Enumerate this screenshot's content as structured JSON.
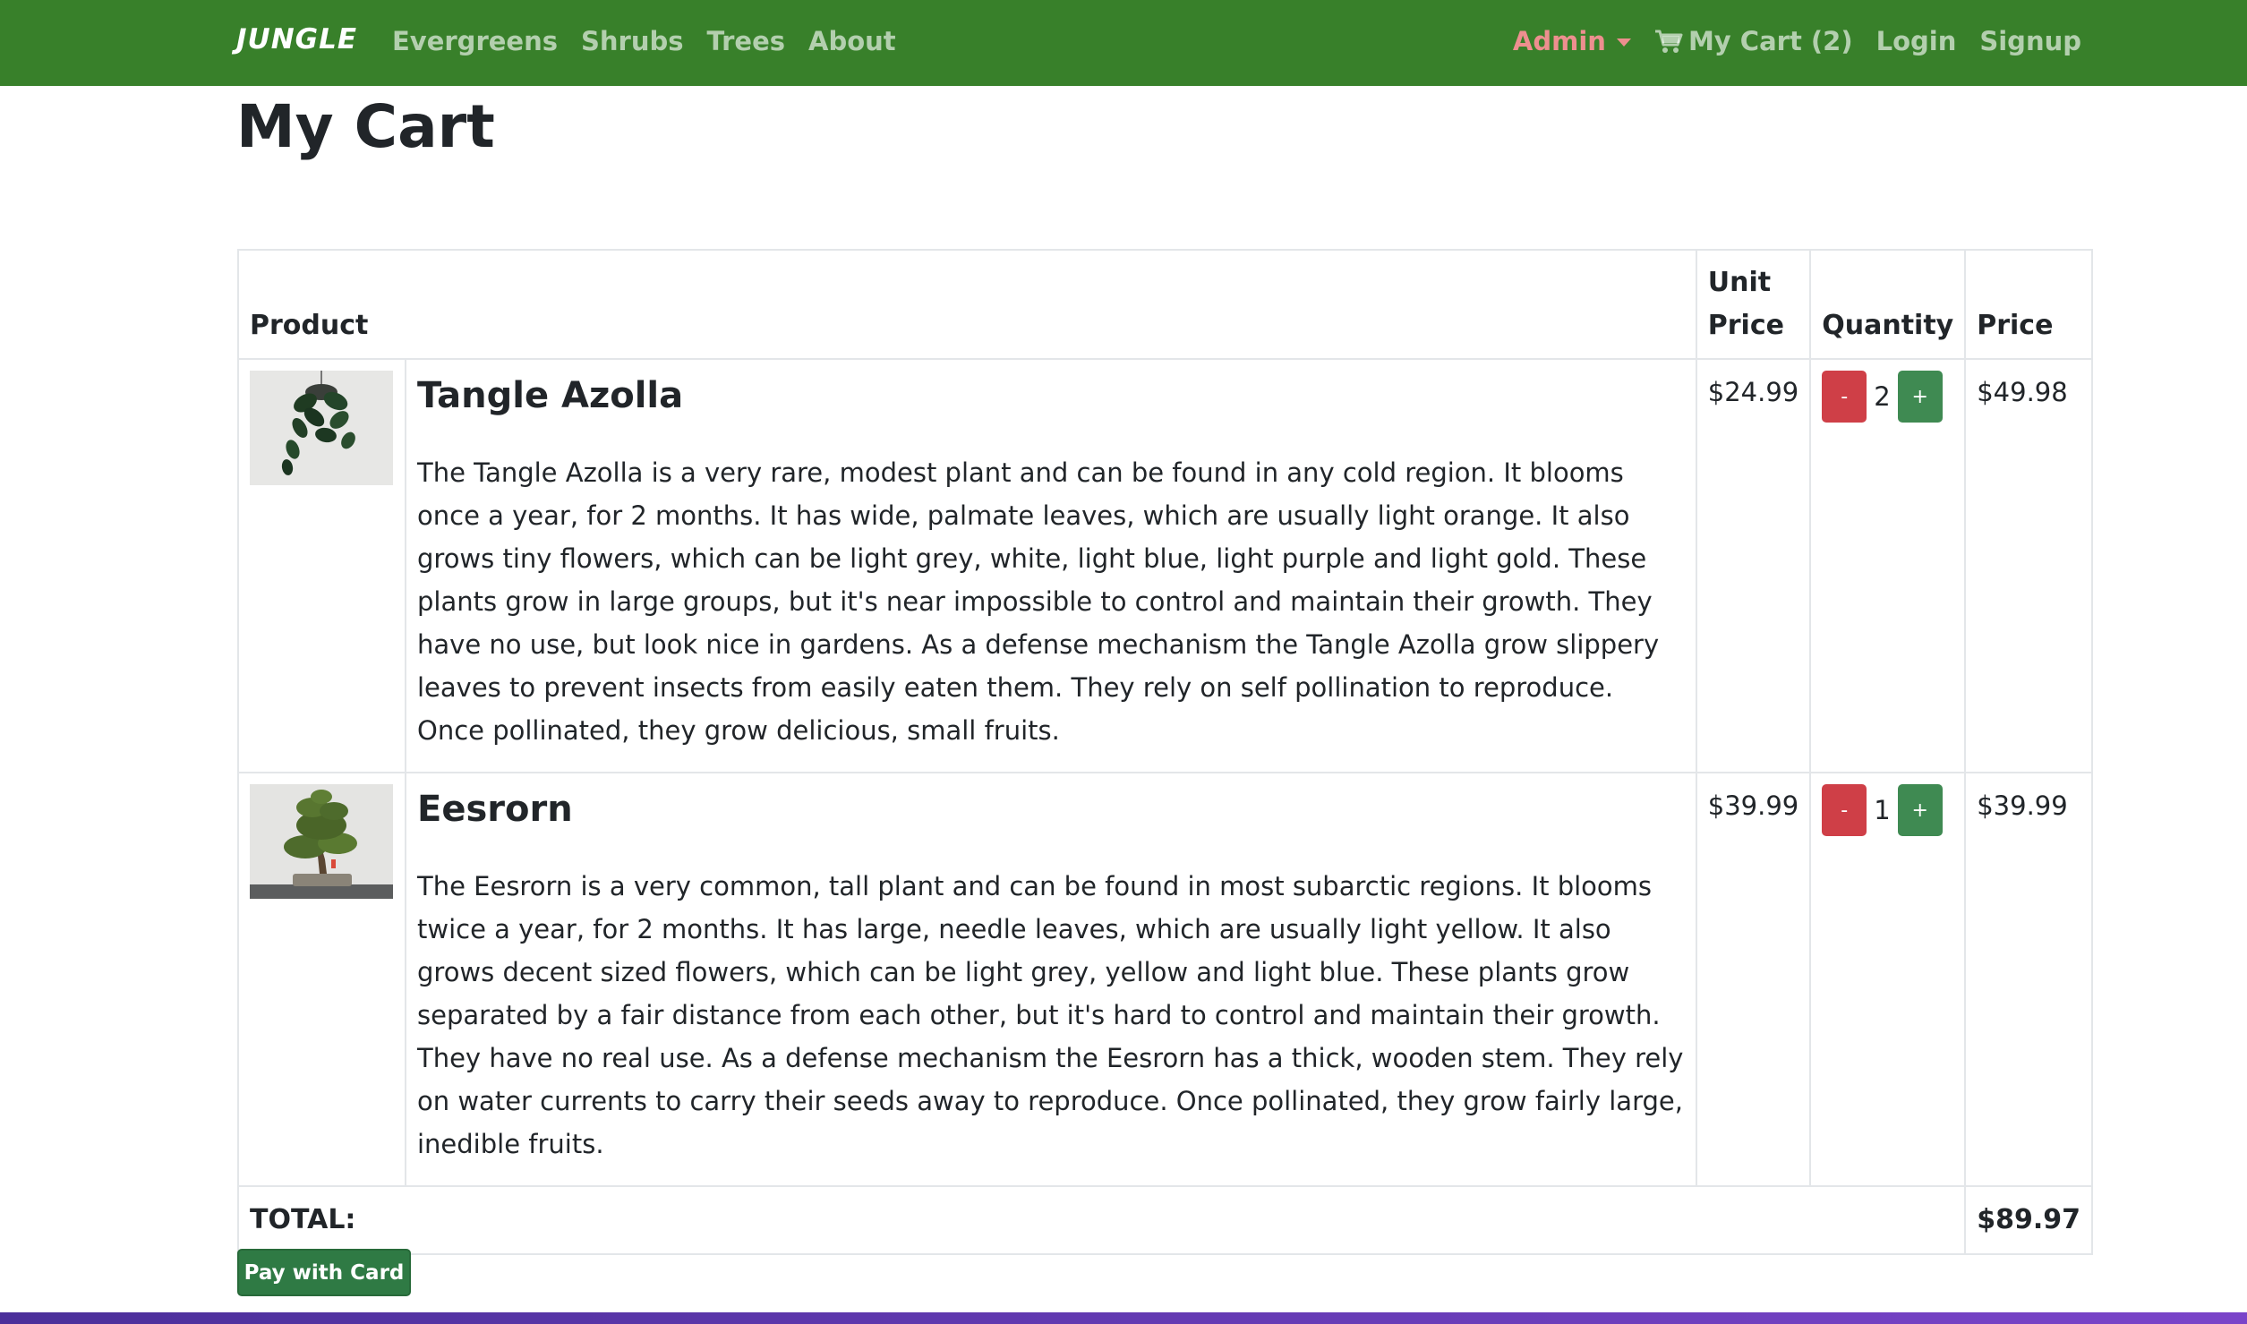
{
  "navbar": {
    "brand": "JUNGLE",
    "links": [
      "Evergreens",
      "Shrubs",
      "Trees",
      "About"
    ],
    "admin_label": "Admin",
    "cart_label": "My Cart (2)",
    "login_label": "Login",
    "signup_label": "Signup",
    "background_color": "#38802a",
    "admin_color": "#ed8f8f"
  },
  "page": {
    "title": "My Cart"
  },
  "table": {
    "headers": {
      "product": "Product",
      "unit_price": "Unit Price",
      "quantity": "Quantity",
      "price": "Price"
    },
    "rows": [
      {
        "image_icon": "hanging-plant-image",
        "name": "Tangle Azolla",
        "description": "The Tangle Azolla is a very rare, modest plant and can be found in any cold region. It blooms once a year, for 2 months. It has wide, palmate leaves, which are usually light orange. It also grows tiny flowers, which can be light grey, white, light blue, light purple and light gold. These plants grow in large groups, but it's near impossible to control and maintain their growth. They have no use, but look nice in gardens. As a defense mechanism the Tangle Azolla grow slippery leaves to prevent insects from easily eaten them. They rely on self pollination to reproduce. Once pollinated, they grow delicious, small fruits.",
        "unit_price": "$24.99",
        "quantity": "2",
        "price": "$49.98"
      },
      {
        "image_icon": "bonsai-tree-image",
        "name": "Eesrorn",
        "description": "The Eesrorn is a very common, tall plant and can be found in most subarctic regions. It blooms twice a year, for 2 months. It has large, needle leaves, which are usually light yellow. It also grows decent sized flowers, which can be light grey, yellow and light blue. These plants grow separated by a fair distance from each other, but it's hard to control and maintain their growth. They have no real use. As a defense mechanism the Eesrorn has a thick, wooden stem. They rely on water currents to carry their seeds away to reproduce. Once pollinated, they grow fairly large, inedible fruits.",
        "unit_price": "$39.99",
        "quantity": "1",
        "price": "$39.99"
      }
    ],
    "decrement_label": "-",
    "increment_label": "+",
    "total_label": "TOTAL:",
    "total_value": "$89.97"
  },
  "checkout": {
    "pay_label": "Pay with Card"
  }
}
